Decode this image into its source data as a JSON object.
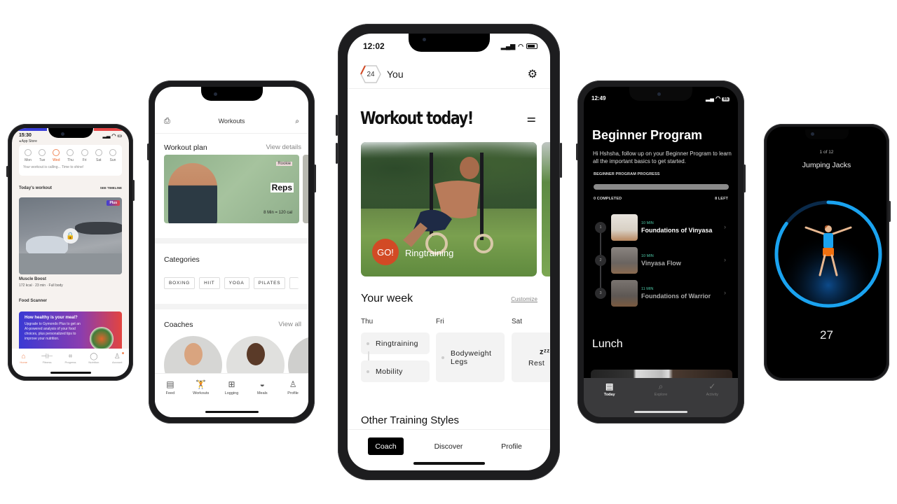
{
  "phone1": {
    "status_time": "15:30",
    "back_link": "◂ App Store",
    "week_days": [
      {
        "label": "Mon",
        "active": false
      },
      {
        "label": "Tue",
        "active": false
      },
      {
        "label": "Wed",
        "active": true
      },
      {
        "label": "Thu",
        "active": false
      },
      {
        "label": "Fri",
        "active": false
      },
      {
        "label": "Sat",
        "active": false
      },
      {
        "label": "Sun",
        "active": false
      }
    ],
    "motivation": "Your workout is calling... Time to shine!",
    "todays_workout_heading": "Today's workout",
    "see_timeline": "SEE TIMELINE",
    "plus_badge": "Plus",
    "workout_title": "Muscle Boost",
    "workout_meta": "172 kcal · 23 min · Full body",
    "food_scanner_heading": "Food Scanner",
    "food_card_title": "How healthy is your meal?",
    "food_card_body": "Upgrade to Gymondo Plus to get an AI-powered analysis of your food choices, plus personalized tips to improve your nutrition.",
    "tabs": [
      {
        "label": "Home",
        "icon": "⌂",
        "active": true
      },
      {
        "label": "Fitness",
        "icon": "⊣⊢",
        "active": false
      },
      {
        "label": "Progress",
        "icon": "⌗",
        "active": false
      },
      {
        "label": "Nutrition",
        "icon": "◯",
        "active": false
      },
      {
        "label": "Account",
        "icon": "♙",
        "active": false
      }
    ],
    "accent_color": "#f08a5d"
  },
  "phone2": {
    "header_title": "Workouts",
    "workout_plan_heading": "Workout plan",
    "view_details": "View details",
    "plan_card": {
      "badge": "Rookie",
      "title": "Reps",
      "meta": "8 Min = 120 cal"
    },
    "categories_heading": "Categories",
    "categories": [
      "BOXING",
      "HIIT",
      "YOGA",
      "PILATES"
    ],
    "coaches_heading": "Coaches",
    "view_all": "View all",
    "tabs": [
      {
        "label": "Feed",
        "icon": "▤",
        "active": false
      },
      {
        "label": "Workouts",
        "icon": "🏋",
        "active": true
      },
      {
        "label": "Logging",
        "icon": "⊞",
        "active": false
      },
      {
        "label": "Meals",
        "icon": "◒",
        "active": false
      },
      {
        "label": "Profile",
        "icon": "♙",
        "active": false
      }
    ]
  },
  "phone3": {
    "status_time": "12:02",
    "streak_count": "24",
    "profile_label": "You",
    "title": "Workout today!",
    "hero": {
      "go_label": "GO!",
      "workout_name": "Ringtraining"
    },
    "your_week_heading": "Your week",
    "customize_link": "Customize",
    "days": [
      {
        "label": "Thu",
        "items": [
          "Ringtraining",
          "Mobility"
        ]
      },
      {
        "label": "Fri",
        "items": [
          "Bodyweight Legs"
        ]
      },
      {
        "label": "Sat",
        "items": [
          "Rest"
        ],
        "rest_icon": "zᶻᶻ"
      }
    ],
    "other_styles_heading": "Other Training Styles",
    "nav": [
      {
        "label": "Coach",
        "active": true
      },
      {
        "label": "Discover",
        "active": false
      },
      {
        "label": "Profile",
        "active": false
      }
    ],
    "go_color": "#d24a25"
  },
  "phone4": {
    "status_time": "12:49",
    "battery": "65",
    "title": "Beginner Program",
    "description": "Hi Hshsha, follow up on your Beginner Program to learn all the important basics to get started.",
    "progress_label": "BEGINNER PROGRAM PROGRESS",
    "completed_label": "0 COMPLETED",
    "left_label": "8 LEFT",
    "progress_fraction": 0,
    "lessons": [
      {
        "number": "1",
        "duration": "10 MIN",
        "name": "Foundations of Vinyasa"
      },
      {
        "number": "2",
        "duration": "10 MIN",
        "name": "Vinyasa Flow"
      },
      {
        "number": "3",
        "duration": "11 MIN",
        "name": "Foundations of Warrior"
      }
    ],
    "lunch_heading": "Lunch",
    "tabs": [
      {
        "label": "Today",
        "icon": "▤",
        "active": true
      },
      {
        "label": "Explore",
        "icon": "⌕",
        "active": false
      },
      {
        "label": "Activity",
        "icon": "✓",
        "active": false
      }
    ],
    "accent_color": "#4ec9a8"
  },
  "phone5": {
    "exercise_count": "1 of 12",
    "exercise_name": "Jumping Jacks",
    "reps_remaining": "27",
    "ring_progress_fraction": 0.85,
    "ring_color": "#1aa3f0"
  }
}
